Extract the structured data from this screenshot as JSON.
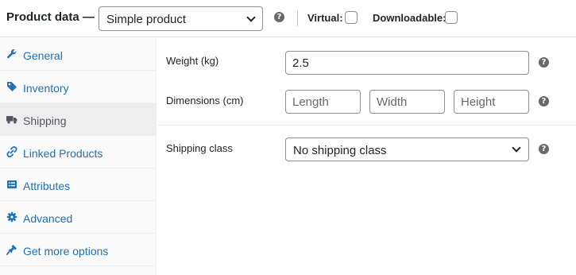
{
  "header": {
    "title": "Product data —",
    "product_type": "Simple product",
    "help_icon": "?",
    "virtual_label": "Virtual:",
    "downloadable_label": "Downloadable:",
    "virtual_checked": false,
    "downloadable_checked": false
  },
  "sidebar": {
    "items": [
      {
        "label": "General",
        "icon": "wrench-icon",
        "active": false
      },
      {
        "label": "Inventory",
        "icon": "tag-icon",
        "active": false
      },
      {
        "label": "Shipping",
        "icon": "truck-icon",
        "active": true
      },
      {
        "label": "Linked Products",
        "icon": "link-icon",
        "active": false
      },
      {
        "label": "Attributes",
        "icon": "list-icon",
        "active": false
      },
      {
        "label": "Advanced",
        "icon": "gear-icon",
        "active": false
      },
      {
        "label": "Get more options",
        "icon": "plugin-icon",
        "active": false
      }
    ]
  },
  "shipping": {
    "weight_label": "Weight (kg)",
    "weight_value": "2.5",
    "dimensions_label": "Dimensions (cm)",
    "length_placeholder": "Length",
    "width_placeholder": "Width",
    "height_placeholder": "Height",
    "shipping_class_label": "Shipping class",
    "shipping_class_value": "No shipping class"
  },
  "colors": {
    "link": "#2271b1",
    "active_tab_bg": "#eeeeee",
    "help_icon_bg": "#646970"
  }
}
